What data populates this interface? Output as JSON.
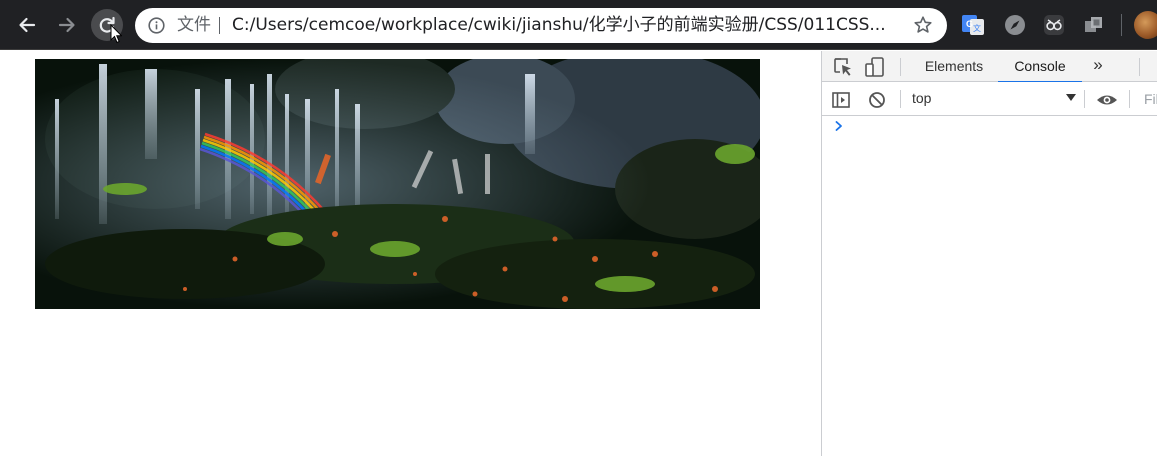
{
  "browser": {
    "security_label": "文件",
    "url": "C:/Users/cemcoe/workplace/cwiki/jianshu/化学小子的前端实验册/CSS/011CSS...",
    "extensions": [
      "google-translate-icon",
      "compass-icon",
      "owl-icon",
      "cubes-icon"
    ]
  },
  "devtools": {
    "tabs": [
      {
        "label": "Elements",
        "active": false
      },
      {
        "label": "Console",
        "active": true
      }
    ],
    "context": "top",
    "filter_placeholder": "Filter"
  },
  "colors": {
    "toolbar": "#202124",
    "accent": "#1a73e8"
  }
}
